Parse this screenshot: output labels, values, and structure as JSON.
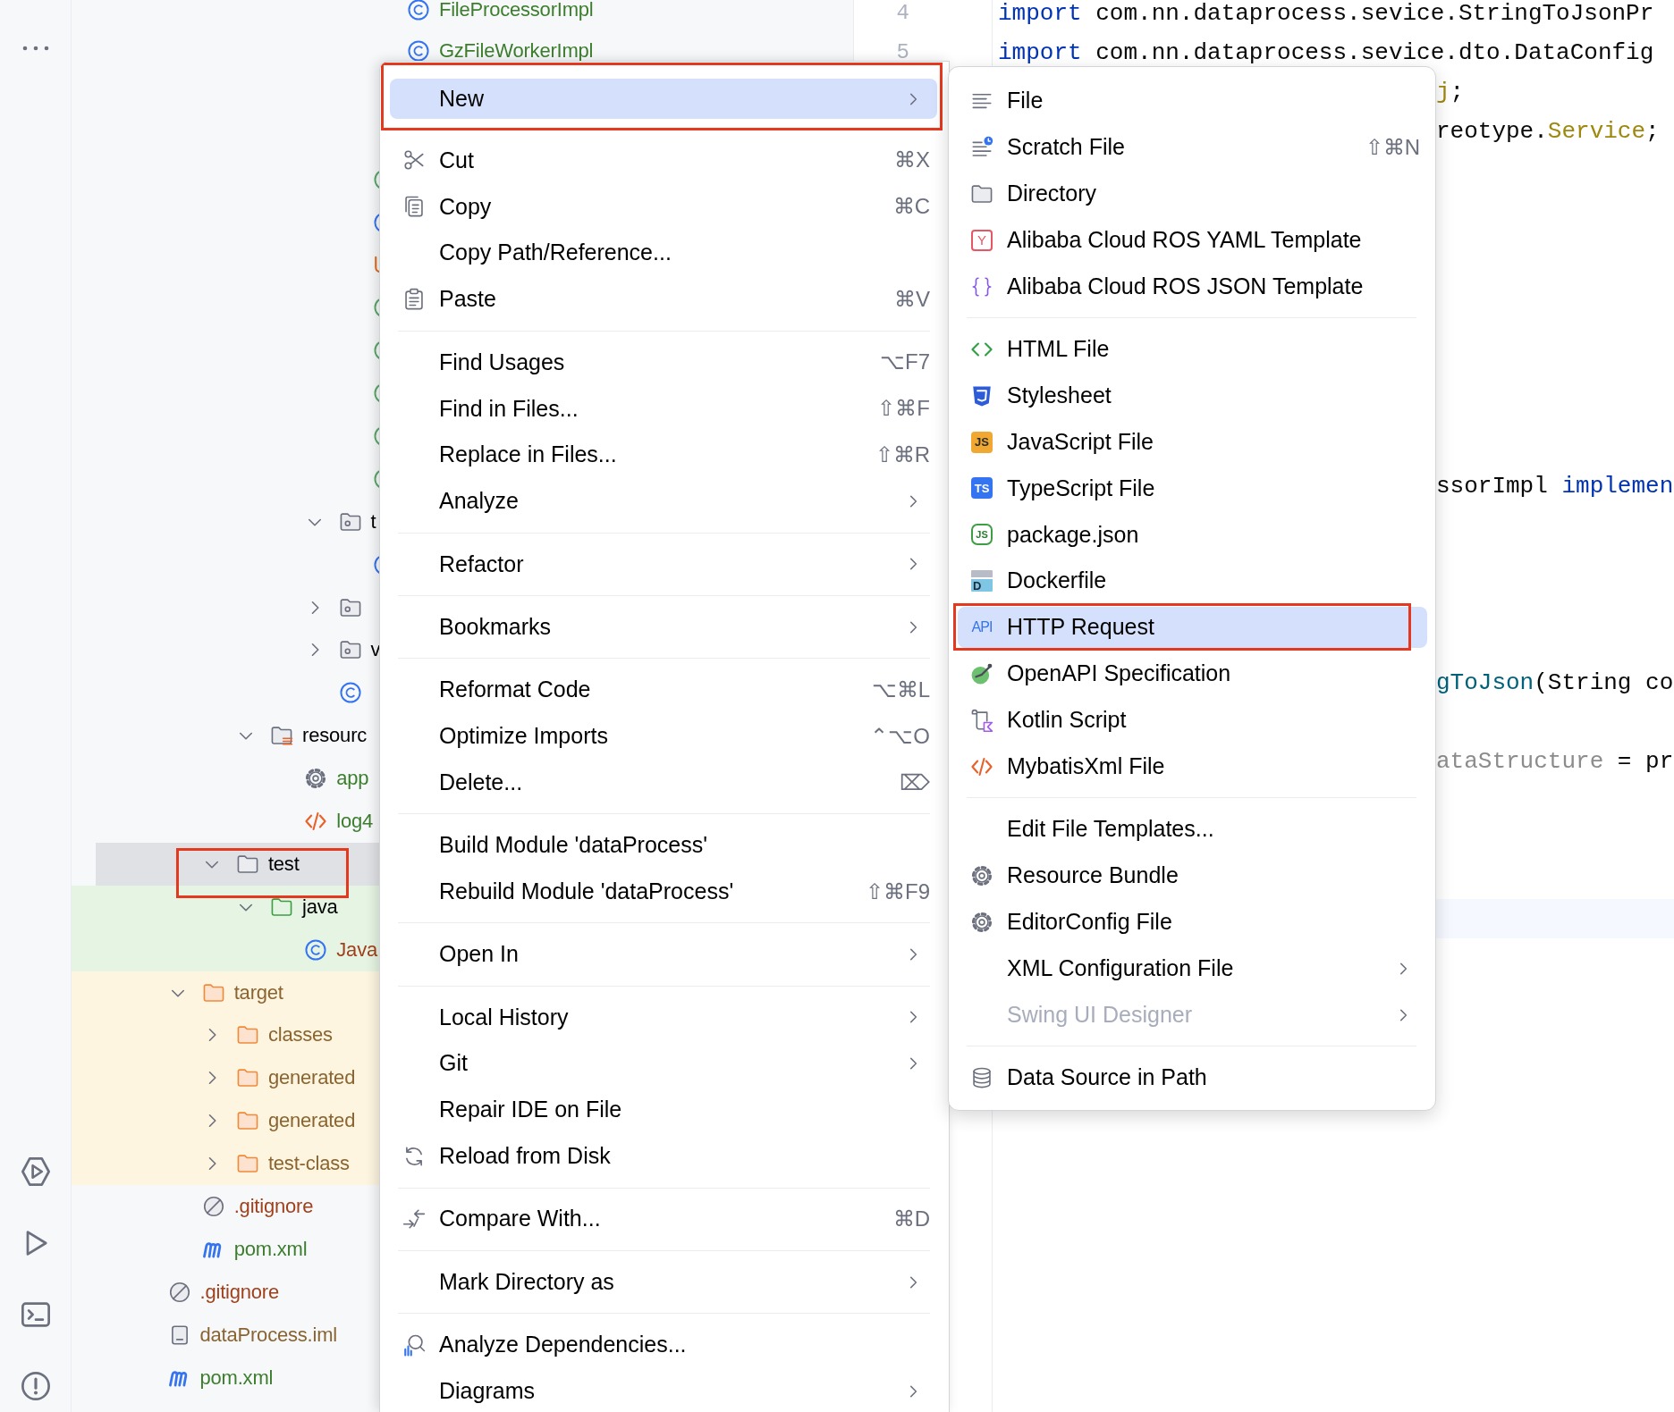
{
  "tree": [
    {
      "children": [
        {
          "children": [
            {
              "children": [
                {
                  "children": [
                    {
                      "children": [
                        {
                          "children": [
                            {
                              "children": [
                                {
                                  "kind": "class",
                                  "label": "FileProcessorImpl",
                                  "color": "#3c7e2d",
                                  "selected": false,
                                  "marked": false
                                },
                                {
                                  "kind": "class",
                                  "label": "GzFileWorkerImpl",
                                  "color": "#3c7e2d",
                                  "selected": false,
                                  "marked": false
                                }
                              ]
                            },
                            {
                              "kind": "class-green",
                              "selected": false,
                              "marked": false
                            },
                            {
                              "kind": "class",
                              "selected": false,
                              "marked": false
                            },
                            {
                              "kind": "mapper",
                              "selected": false,
                              "marked": false
                            },
                            {
                              "kind": "class-green",
                              "selected": false,
                              "marked": false
                            },
                            {
                              "kind": "class-green",
                              "selected": false,
                              "marked": false
                            },
                            {
                              "kind": "class-green",
                              "selected": false,
                              "marked": false
                            },
                            {
                              "kind": "class-green",
                              "selected": false,
                              "marked": false
                            },
                            {
                              "kind": "class-green",
                              "selected": false,
                              "marked": false
                            }
                          ]
                        },
                        {
                          "kind": "folder-package",
                          "label": "t",
                          "expanded": true,
                          "selected": false,
                          "marked": false,
                          "children": [
                            {
                              "kind": "class",
                              "selected": false,
                              "marked": false
                            }
                          ]
                        },
                        {
                          "kind": "folder-package",
                          "expanded": false,
                          "selected": false,
                          "marked": false
                        },
                        {
                          "kind": "folder-package",
                          "label": "v",
                          "expanded": false,
                          "selected": false,
                          "marked": false
                        },
                        {
                          "kind": "class",
                          "selected": false,
                          "marked": false
                        }
                      ]
                    }
                  ]
                },
                {
                  "kind": "folder-resources",
                  "label": "resourc",
                  "expanded": true,
                  "selected": false,
                  "marked": false,
                  "children": [
                    {
                      "kind": "gear",
                      "label": "app",
                      "color": "#3c7e2d",
                      "selected": false,
                      "marked": false
                    },
                    {
                      "kind": "xml",
                      "label": "log4",
                      "color": "#3c7e2d",
                      "selected": false,
                      "marked": false
                    }
                  ]
                }
              ]
            },
            {
              "kind": "folder",
              "label": "test",
              "expanded": true,
              "selected": true,
              "marked": true,
              "children": [
                {
                  "kind": "folder-test",
                  "label": "java",
                  "expanded": true,
                  "test_source": true,
                  "selected": false,
                  "marked": false,
                  "children": [
                    {
                      "kind": "class",
                      "label": "Java",
                      "color": "#a0401c",
                      "test_source": true,
                      "selected": false,
                      "marked": false
                    }
                  ]
                }
              ]
            }
          ]
        },
        {
          "kind": "folder-excluded",
          "label": "target",
          "color": "#8a6431",
          "excluded": true,
          "expanded": true,
          "selected": false,
          "marked": false,
          "children": [
            {
              "kind": "folder-excluded",
              "label": "classes",
              "color": "#8a6431",
              "excluded": true,
              "expanded": false,
              "selected": false,
              "marked": false
            },
            {
              "kind": "folder-excluded",
              "label": "generated",
              "color": "#8a6431",
              "excluded": true,
              "expanded": false,
              "selected": false,
              "marked": false
            },
            {
              "kind": "folder-excluded",
              "label": "generated",
              "color": "#8a6431",
              "excluded": true,
              "expanded": false,
              "selected": false,
              "marked": false
            },
            {
              "kind": "folder-excluded",
              "label": "test-class",
              "color": "#8a6431",
              "excluded": true,
              "expanded": false,
              "selected": false,
              "marked": false
            }
          ]
        },
        {
          "kind": "ignore",
          "label": ".gitignore",
          "color": "#a0401c",
          "selected": false,
          "marked": false
        },
        {
          "kind": "maven",
          "label": "pom.xml",
          "color": "#3c7e2d",
          "selected": false,
          "marked": false
        }
      ]
    },
    {
      "kind": "ignore",
      "label": ".gitignore",
      "color": "#a0401c",
      "selected": false,
      "marked": false
    },
    {
      "kind": "iml",
      "label": "dataProcess.iml",
      "color": "#8a6431",
      "selected": false,
      "marked": false
    },
    {
      "kind": "maven",
      "label": "pom.xml",
      "color": "#3c7e2d",
      "selected": false,
      "marked": false
    }
  ],
  "editor": {
    "current_line_highlight": true,
    "lines": [
      {
        "number": "4",
        "tokens": [
          {
            "kind": "keyword",
            "text": "import"
          },
          {
            "kind": "plain",
            "text": " com.nn.dataprocess.sevice.StringToJsonPr"
          }
        ]
      },
      {
        "number": "5",
        "tokens": [
          {
            "kind": "keyword",
            "text": "import"
          },
          {
            "kind": "plain",
            "text": " com.nn.dataprocess.sevice.dto.DataConfig"
          }
        ]
      },
      {
        "tokens": [
          {
            "kind": "annotation",
            "text": "j"
          },
          {
            "kind": "plain",
            "text": ";"
          }
        ]
      },
      {
        "tokens": [
          {
            "kind": "plain",
            "text": "reotype."
          },
          {
            "kind": "annotation",
            "text": "Service"
          },
          {
            "kind": "plain",
            "text": ";"
          }
        ]
      },
      {
        "tokens": [
          {
            "kind": "plain",
            "text": "ssorImpl "
          },
          {
            "kind": "keyword",
            "text": "implemen"
          }
        ]
      },
      {
        "tokens": [
          {
            "kind": "method",
            "text": "gToJson"
          },
          {
            "kind": "plain",
            "text": "(String co"
          }
        ]
      },
      {
        "tokens": [
          {
            "kind": "unused",
            "text": "ataStructure"
          },
          {
            "kind": "plain",
            "text": " = pr"
          }
        ]
      }
    ]
  },
  "context_menu": [
    {
      "kind": "plain",
      "label": "New",
      "submenu": true,
      "selected": true,
      "marked": true
    },
    {
      "kind": "scissors",
      "label": "Cut",
      "shortcut": "⌘X",
      "submenu": false,
      "selected": false,
      "marked": false
    },
    {
      "kind": "copy",
      "label": "Copy",
      "shortcut": "⌘C",
      "submenu": false,
      "selected": false,
      "marked": false
    },
    {
      "kind": "plain",
      "label": "Copy Path/Reference...",
      "submenu": false,
      "selected": false,
      "marked": false
    },
    {
      "kind": "paste",
      "label": "Paste",
      "shortcut": "⌘V",
      "submenu": false,
      "selected": false,
      "marked": false
    },
    {
      "kind": "separator"
    },
    {
      "kind": "plain",
      "label": "Find Usages",
      "shortcut": "⌥F7",
      "submenu": false,
      "selected": false,
      "marked": false
    },
    {
      "kind": "plain",
      "label": "Find in Files...",
      "shortcut": "⇧⌘F",
      "submenu": false,
      "selected": false,
      "marked": false
    },
    {
      "kind": "plain",
      "label": "Replace in Files...",
      "shortcut": "⇧⌘R",
      "submenu": false,
      "selected": false,
      "marked": false
    },
    {
      "kind": "plain",
      "label": "Analyze",
      "submenu": true,
      "selected": false,
      "marked": false
    },
    {
      "kind": "separator"
    },
    {
      "kind": "plain",
      "label": "Refactor",
      "submenu": true,
      "selected": false,
      "marked": false
    },
    {
      "kind": "separator"
    },
    {
      "kind": "plain",
      "label": "Bookmarks",
      "submenu": true,
      "selected": false,
      "marked": false
    },
    {
      "kind": "separator"
    },
    {
      "kind": "plain",
      "label": "Reformat Code",
      "shortcut": "⌥⌘L",
      "submenu": false,
      "selected": false,
      "marked": false
    },
    {
      "kind": "plain",
      "label": "Optimize Imports",
      "shortcut": "⌃⌥O",
      "submenu": false,
      "selected": false,
      "marked": false
    },
    {
      "kind": "plain",
      "label": "Delete...",
      "shortcut": "⌦",
      "submenu": false,
      "selected": false,
      "marked": false
    },
    {
      "kind": "separator"
    },
    {
      "kind": "plain",
      "label": "Build Module 'dataProcess'",
      "submenu": false,
      "selected": false,
      "marked": false
    },
    {
      "kind": "plain",
      "label": "Rebuild Module 'dataProcess'",
      "shortcut": "⇧⌘F9",
      "submenu": false,
      "selected": false,
      "marked": false
    },
    {
      "kind": "separator"
    },
    {
      "kind": "plain",
      "label": "Open In",
      "submenu": true,
      "selected": false,
      "marked": false
    },
    {
      "kind": "separator"
    },
    {
      "kind": "plain",
      "label": "Local History",
      "submenu": true,
      "selected": false,
      "marked": false
    },
    {
      "kind": "plain",
      "label": "Git",
      "submenu": true,
      "selected": false,
      "marked": false
    },
    {
      "kind": "plain",
      "label": "Repair IDE on File",
      "submenu": false,
      "selected": false,
      "marked": false
    },
    {
      "kind": "reload",
      "label": "Reload from Disk",
      "submenu": false,
      "selected": false,
      "marked": false
    },
    {
      "kind": "separator"
    },
    {
      "kind": "compare",
      "label": "Compare With...",
      "shortcut": "⌘D",
      "submenu": false,
      "selected": false,
      "marked": false
    },
    {
      "kind": "separator"
    },
    {
      "kind": "plain",
      "label": "Mark Directory as",
      "submenu": true,
      "selected": false,
      "marked": false
    },
    {
      "kind": "separator"
    },
    {
      "kind": "analyze",
      "label": "Analyze Dependencies...",
      "submenu": false,
      "selected": false,
      "marked": false
    },
    {
      "kind": "plain",
      "label": "Diagrams",
      "submenu": true,
      "selected": false,
      "marked": false
    }
  ],
  "new_submenu": [
    {
      "kind": "lines",
      "label": "File",
      "submenu": false,
      "selected": false,
      "disabled": false,
      "marked": false
    },
    {
      "kind": "scratch",
      "label": "Scratch File",
      "shortcut": "⇧⌘N",
      "submenu": false,
      "selected": false,
      "disabled": false,
      "marked": false
    },
    {
      "kind": "directory",
      "label": "Directory",
      "submenu": false,
      "selected": false,
      "disabled": false,
      "marked": false
    },
    {
      "kind": "yaml",
      "icon_text": "Y",
      "label": "Alibaba Cloud ROS YAML Template",
      "submenu": false,
      "selected": false,
      "disabled": false,
      "marked": false
    },
    {
      "kind": "braces",
      "label": "Alibaba Cloud ROS JSON Template",
      "submenu": false,
      "selected": false,
      "disabled": false,
      "marked": false
    },
    {
      "kind": "separator"
    },
    {
      "kind": "html",
      "label": "HTML File",
      "submenu": false,
      "selected": false,
      "disabled": false,
      "marked": false
    },
    {
      "kind": "css",
      "label": "Stylesheet",
      "submenu": false,
      "selected": false,
      "disabled": false,
      "marked": false
    },
    {
      "kind": "js",
      "icon_text": "JS",
      "label": "JavaScript File",
      "submenu": false,
      "selected": false,
      "disabled": false,
      "marked": false
    },
    {
      "kind": "ts",
      "icon_text": "TS",
      "label": "TypeScript File",
      "submenu": false,
      "selected": false,
      "disabled": false,
      "marked": false
    },
    {
      "kind": "node",
      "icon_text": "JS",
      "label": "package.json",
      "submenu": false,
      "selected": false,
      "disabled": false,
      "marked": false
    },
    {
      "kind": "docker",
      "icon_text": "D",
      "label": "Dockerfile",
      "submenu": false,
      "selected": false,
      "disabled": false,
      "marked": false
    },
    {
      "kind": "http",
      "icon_text": "API",
      "label": "HTTP Request",
      "submenu": false,
      "selected": true,
      "disabled": false,
      "marked": true
    },
    {
      "kind": "openapi",
      "label": "OpenAPI Specification",
      "submenu": false,
      "selected": false,
      "disabled": false,
      "marked": false
    },
    {
      "kind": "kotlin",
      "label": "Kotlin Script",
      "submenu": false,
      "selected": false,
      "disabled": false,
      "marked": false
    },
    {
      "kind": "xml",
      "label": "MybatisXml File",
      "submenu": false,
      "selected": false,
      "disabled": false,
      "marked": false
    },
    {
      "kind": "separator"
    },
    {
      "kind": "plain",
      "label": "Edit File Templates...",
      "submenu": false,
      "selected": false,
      "disabled": false,
      "marked": false
    },
    {
      "kind": "gear",
      "label": "Resource Bundle",
      "submenu": false,
      "selected": false,
      "disabled": false,
      "marked": false
    },
    {
      "kind": "gear",
      "label": "EditorConfig File",
      "submenu": false,
      "selected": false,
      "disabled": false,
      "marked": false
    },
    {
      "kind": "plain",
      "label": "XML Configuration File",
      "submenu": true,
      "selected": false,
      "disabled": false,
      "marked": false
    },
    {
      "kind": "plain",
      "label": "Swing UI Designer",
      "submenu": true,
      "selected": false,
      "disabled": true,
      "marked": false
    },
    {
      "kind": "separator"
    },
    {
      "kind": "database",
      "label": "Data Source in Path",
      "submenu": false,
      "selected": false,
      "disabled": false,
      "marked": false
    }
  ]
}
